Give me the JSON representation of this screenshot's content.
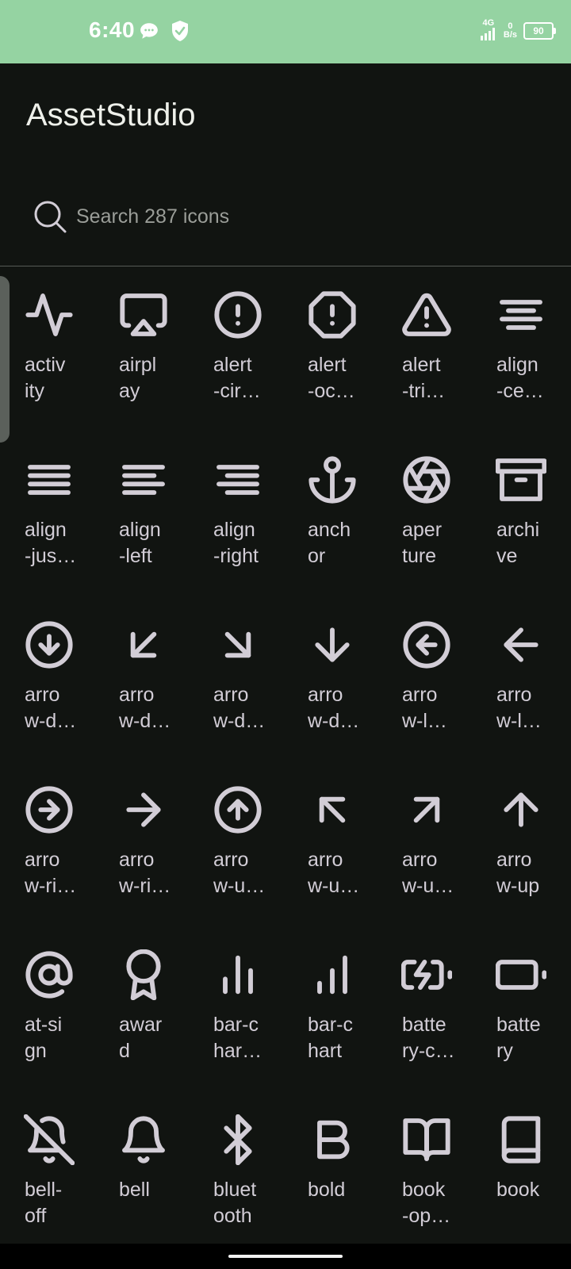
{
  "status": {
    "time": "6:40",
    "network": "4G",
    "speed_value": "0",
    "speed_unit": "B/s",
    "battery": "90"
  },
  "app": {
    "title": "AssetStudio"
  },
  "search": {
    "placeholder": "Search 287 icons"
  },
  "icons": [
    {
      "label": "activ\nity",
      "icon": "activity-icon"
    },
    {
      "label": "airpl\nay",
      "icon": "airplay-icon"
    },
    {
      "label": "alert\n-cir…",
      "icon": "alert-circle-icon"
    },
    {
      "label": "alert\n-oc…",
      "icon": "alert-octagon-icon"
    },
    {
      "label": "alert\n-tri…",
      "icon": "alert-triangle-icon"
    },
    {
      "label": "align\n-ce…",
      "icon": "align-center-icon"
    },
    {
      "label": "align\n-jus…",
      "icon": "align-justify-icon"
    },
    {
      "label": "align\n-left",
      "icon": "align-left-icon"
    },
    {
      "label": "align\n-right",
      "icon": "align-right-icon"
    },
    {
      "label": "anch\nor",
      "icon": "anchor-icon"
    },
    {
      "label": "aper\nture",
      "icon": "aperture-icon"
    },
    {
      "label": "archi\nve",
      "icon": "archive-icon"
    },
    {
      "label": "arro\nw-d…",
      "icon": "arrow-down-circle-icon"
    },
    {
      "label": "arro\nw-d…",
      "icon": "arrow-down-left-icon"
    },
    {
      "label": "arro\nw-d…",
      "icon": "arrow-down-right-icon"
    },
    {
      "label": "arro\nw-d…",
      "icon": "arrow-down-icon"
    },
    {
      "label": "arro\nw-l…",
      "icon": "arrow-left-circle-icon"
    },
    {
      "label": "arro\nw-l…",
      "icon": "arrow-left-icon"
    },
    {
      "label": "arro\nw-ri…",
      "icon": "arrow-right-circle-icon"
    },
    {
      "label": "arro\nw-ri…",
      "icon": "arrow-right-icon"
    },
    {
      "label": "arro\nw-u…",
      "icon": "arrow-up-circle-icon"
    },
    {
      "label": "arro\nw-u…",
      "icon": "arrow-up-left-icon"
    },
    {
      "label": "arro\nw-u…",
      "icon": "arrow-up-right-icon"
    },
    {
      "label": "arro\nw-up",
      "icon": "arrow-up-icon"
    },
    {
      "label": "at-si\ngn",
      "icon": "at-sign-icon"
    },
    {
      "label": "awar\nd",
      "icon": "award-icon"
    },
    {
      "label": "bar-c\nhar…",
      "icon": "bar-chart-2-icon"
    },
    {
      "label": "bar-c\nhart",
      "icon": "bar-chart-icon"
    },
    {
      "label": "batte\nry-c…",
      "icon": "battery-charging-icon"
    },
    {
      "label": "batte\nry",
      "icon": "battery-icon"
    },
    {
      "label": "bell-\noff",
      "icon": "bell-off-icon"
    },
    {
      "label": "bell",
      "icon": "bell-icon"
    },
    {
      "label": "bluet\nooth",
      "icon": "bluetooth-icon"
    },
    {
      "label": "bold",
      "icon": "bold-icon"
    },
    {
      "label": "book\n-op…",
      "icon": "book-open-icon"
    },
    {
      "label": "book",
      "icon": "book-icon"
    }
  ]
}
